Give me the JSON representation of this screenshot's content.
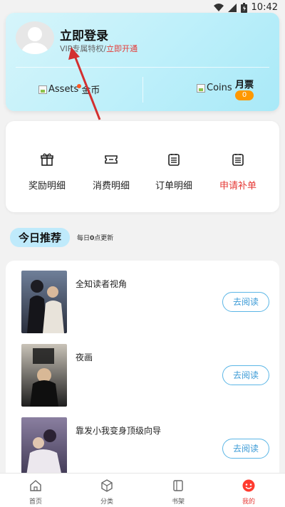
{
  "statusbar": {
    "time": "10:42"
  },
  "profile": {
    "login_title": "立即登录",
    "vip_text": "VIP专属特权/",
    "vip_open": "立即开通",
    "assets_alt": "Assets",
    "gold_label": "金币",
    "coins_alt": "Coins",
    "yuepiao_label": "月票",
    "yuepiao_count": "0"
  },
  "menu": {
    "items": [
      {
        "label": "奖励明细",
        "icon": "gift-icon"
      },
      {
        "label": "消费明细",
        "icon": "ticket-icon"
      },
      {
        "label": "订单明细",
        "icon": "order-icon"
      },
      {
        "label": "申请补单",
        "icon": "order-icon"
      }
    ]
  },
  "section": {
    "title": "今日推荐",
    "sub_prefix": "每日",
    "sub_num": "0",
    "sub_suffix": "点更新"
  },
  "books": [
    {
      "title": "全知读者视角",
      "button": "去阅读"
    },
    {
      "title": "夜画",
      "button": "去阅读"
    },
    {
      "title": "靠发小我变身顶级向导",
      "button": "去阅读"
    }
  ],
  "tabs": [
    {
      "label": "首页",
      "icon": "home-icon"
    },
    {
      "label": "分类",
      "icon": "category-icon"
    },
    {
      "label": "书架",
      "icon": "bookshelf-icon"
    },
    {
      "label": "我的",
      "icon": "profile-icon"
    }
  ],
  "colors": {
    "accent": "#e53935",
    "button": "#3a9ad6",
    "card_gradient": "#bff0fa",
    "badge": "#ff9800"
  }
}
